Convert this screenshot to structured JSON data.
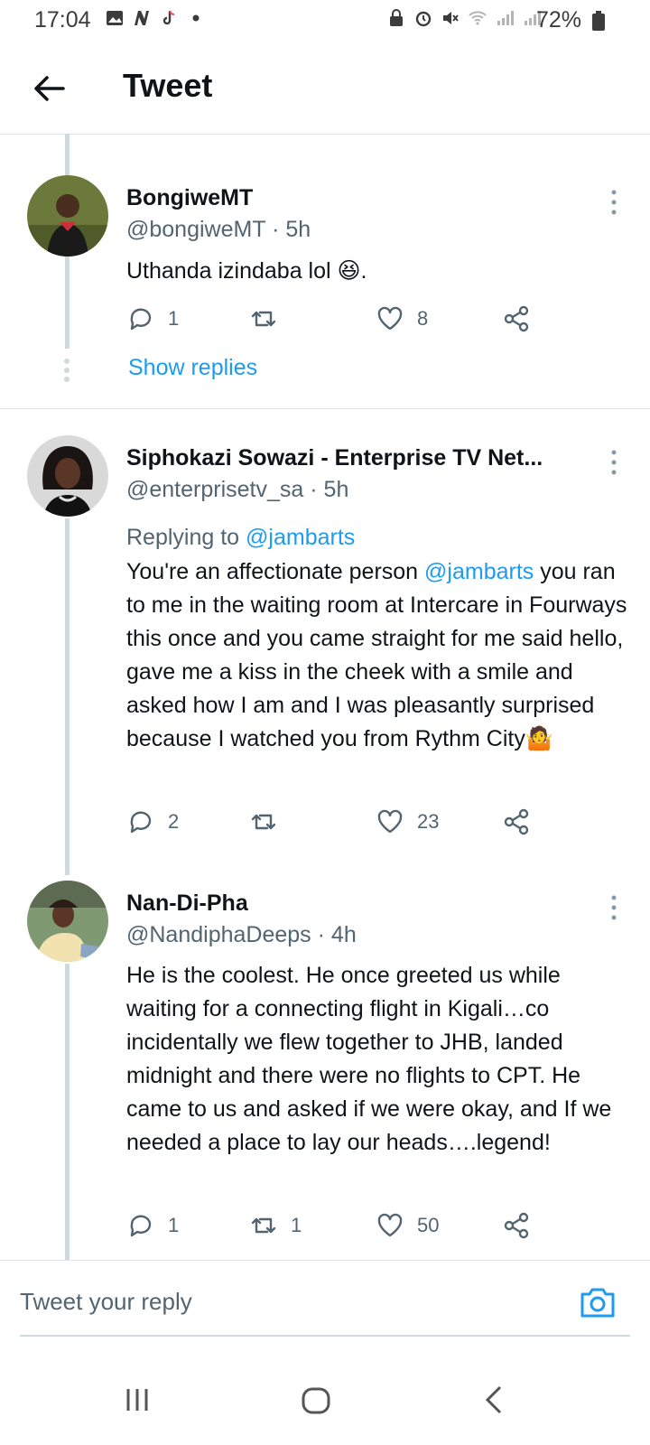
{
  "status_bar": {
    "time": "17:04",
    "battery": "72%",
    "left_icons": [
      "gallery-icon",
      "n-app-icon",
      "tiktok-icon",
      "dot-icon"
    ],
    "right_icons": [
      "lock-icon",
      "alarm-icon",
      "mute-icon",
      "wifi-icon",
      "signal-icon",
      "signal-icon",
      "battery-icon"
    ]
  },
  "header": {
    "title": "Tweet"
  },
  "tweets": [
    {
      "name": "BongiweMT",
      "handle": "@bongiweMT",
      "time": "· 5h",
      "text": "Uthanda izindaba lol 😆.",
      "replies": "1",
      "retweets": "",
      "likes": "8",
      "show_replies": "Show replies"
    },
    {
      "name": "Siphokazi Sowazi - Enterprise TV Net...",
      "handle": "@enterprisetv_sa",
      "time": "· 5h",
      "replying_prefix": "Replying to ",
      "replying_to": "@jambarts",
      "text_a": "You're an affectionate person ",
      "mention": "@jambarts",
      "text_b": " you ran to me in the waiting room at Intercare in Fourways this once and you came straight for me said hello, gave me a kiss in the cheek with a smile and asked how I am and I was pleasantly surprised because I watched you from Rythm City🤷",
      "replies": "2",
      "retweets": "",
      "likes": "23"
    },
    {
      "name": "Nan-Di-Pha",
      "handle": "@NandiphaDeeps",
      "time": "· 4h",
      "text": "He is the coolest. He once greeted us while waiting for a connecting flight  in Kigali…co incidentally we flew together to JHB, landed midnight and there were no flights to CPT. He came to us and asked if we were okay, and If we needed a place to lay our heads….legend!",
      "replies": "1",
      "retweets": "1",
      "likes": "50"
    }
  ],
  "reply_bar": {
    "placeholder": "Tweet your reply"
  },
  "colors": {
    "accent": "#1d9bf0",
    "text": "#0f1419",
    "muted": "#536471",
    "thread_line": "#cfd9de"
  }
}
